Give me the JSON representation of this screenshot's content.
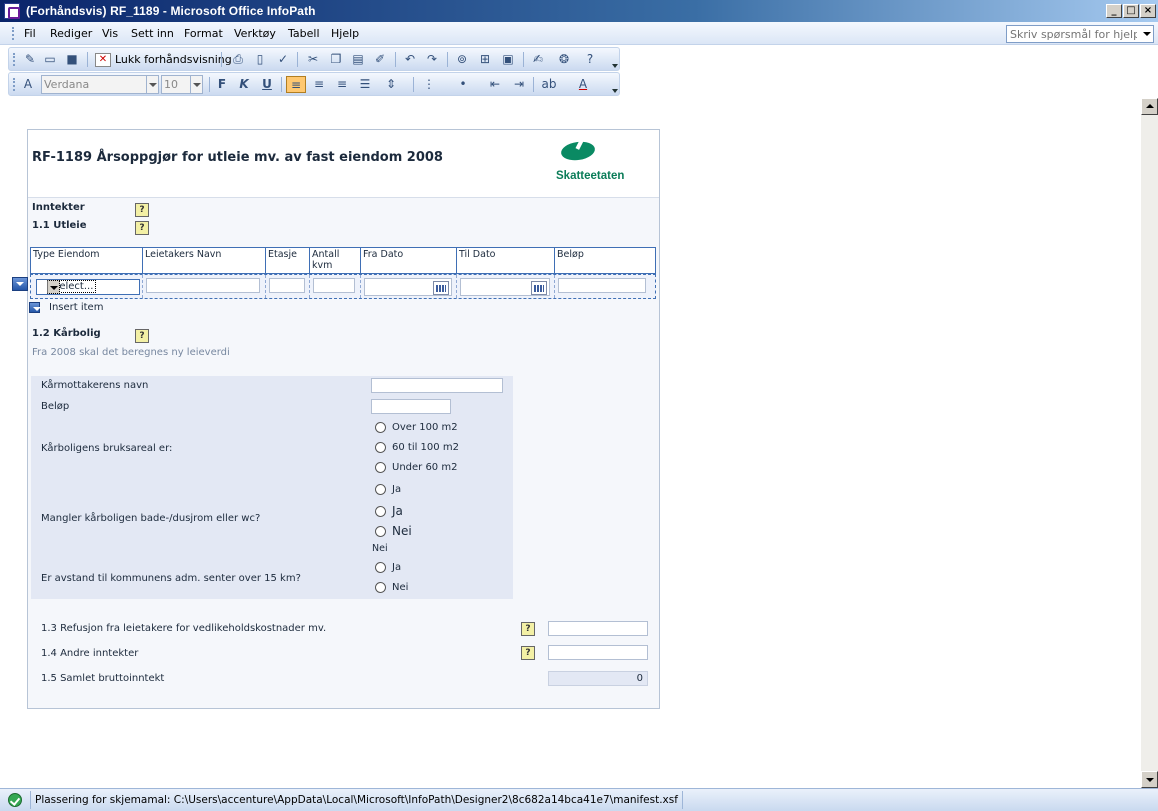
{
  "window": {
    "title": "(Forhåndsvis) RF_1189 - Microsoft Office InfoPath",
    "buttons": [
      "minimize",
      "maximize",
      "close"
    ]
  },
  "menu": {
    "items": [
      "Fil",
      "Rediger",
      "Vis",
      "Sett inn",
      "Format",
      "Verktøy",
      "Tabell",
      "Hjelp"
    ],
    "help_placeholder": "Skriv spørsmål for hjelp"
  },
  "toolbar": {
    "close_preview_label": "Lukk forhåndsvisning",
    "font_name": "Verdana",
    "font_size": "10",
    "bold": "F",
    "italic": "K",
    "underline": "U"
  },
  "form": {
    "title": "RF-1189 Årsoppgjør for utleie mv. av fast eiendom 2008",
    "logo_text": "Skatteetaten",
    "help_glyph": "?",
    "inntekter_label": "Inntekter",
    "utleie_label": "1.1 Utleie",
    "table": {
      "headers": [
        "Type Eiendom",
        "Leietakers Navn",
        "Etasje",
        "Antall kvm",
        "Fra Dato",
        "Til Dato",
        "Beløp"
      ],
      "type_select_value": "Select..."
    },
    "insert_item": "Insert item",
    "karbolig": {
      "heading": "1.2 Kårbolig",
      "note": "Fra 2008 skal det beregnes ny leieverdi",
      "name_label": "Kårmottakerens navn",
      "amount_label": "Beløp",
      "area_label": "Kårboligens bruksareal er:",
      "area_options": [
        "Over 100 m2",
        "60 til 100 m2",
        "Under 60 m2"
      ],
      "bath_label": "Mangler kårboligen bade-/dusjrom eller wc?",
      "bath_option_small": "Ja",
      "bath_options_large": [
        "Ja",
        "Nei"
      ],
      "bath_value_text": "Nei",
      "distance_label": "Er avstand til kommunens adm. senter over 15 km?",
      "distance_options": [
        "Ja",
        "Nei"
      ]
    },
    "refusjon_label": "1.3 Refusjon fra leietakere for vedlikeholdskostnader mv.",
    "andre_label": "1.4 Andre inntekter",
    "samlet_label": "1.5 Samlet bruttoinntekt",
    "samlet_value": "0"
  },
  "status": {
    "text": "Plassering for skjemamal: C:\\Users\\accenture\\AppData\\Local\\Microsoft\\InfoPath\\Designer2\\8c682a14bca41e7\\manifest.xsf"
  },
  "colors": {
    "title_bar": "#0a246a",
    "logo_green": "#0a8a63",
    "table_border": "#3f6fb5",
    "section_bg": "#e3e8f4"
  }
}
